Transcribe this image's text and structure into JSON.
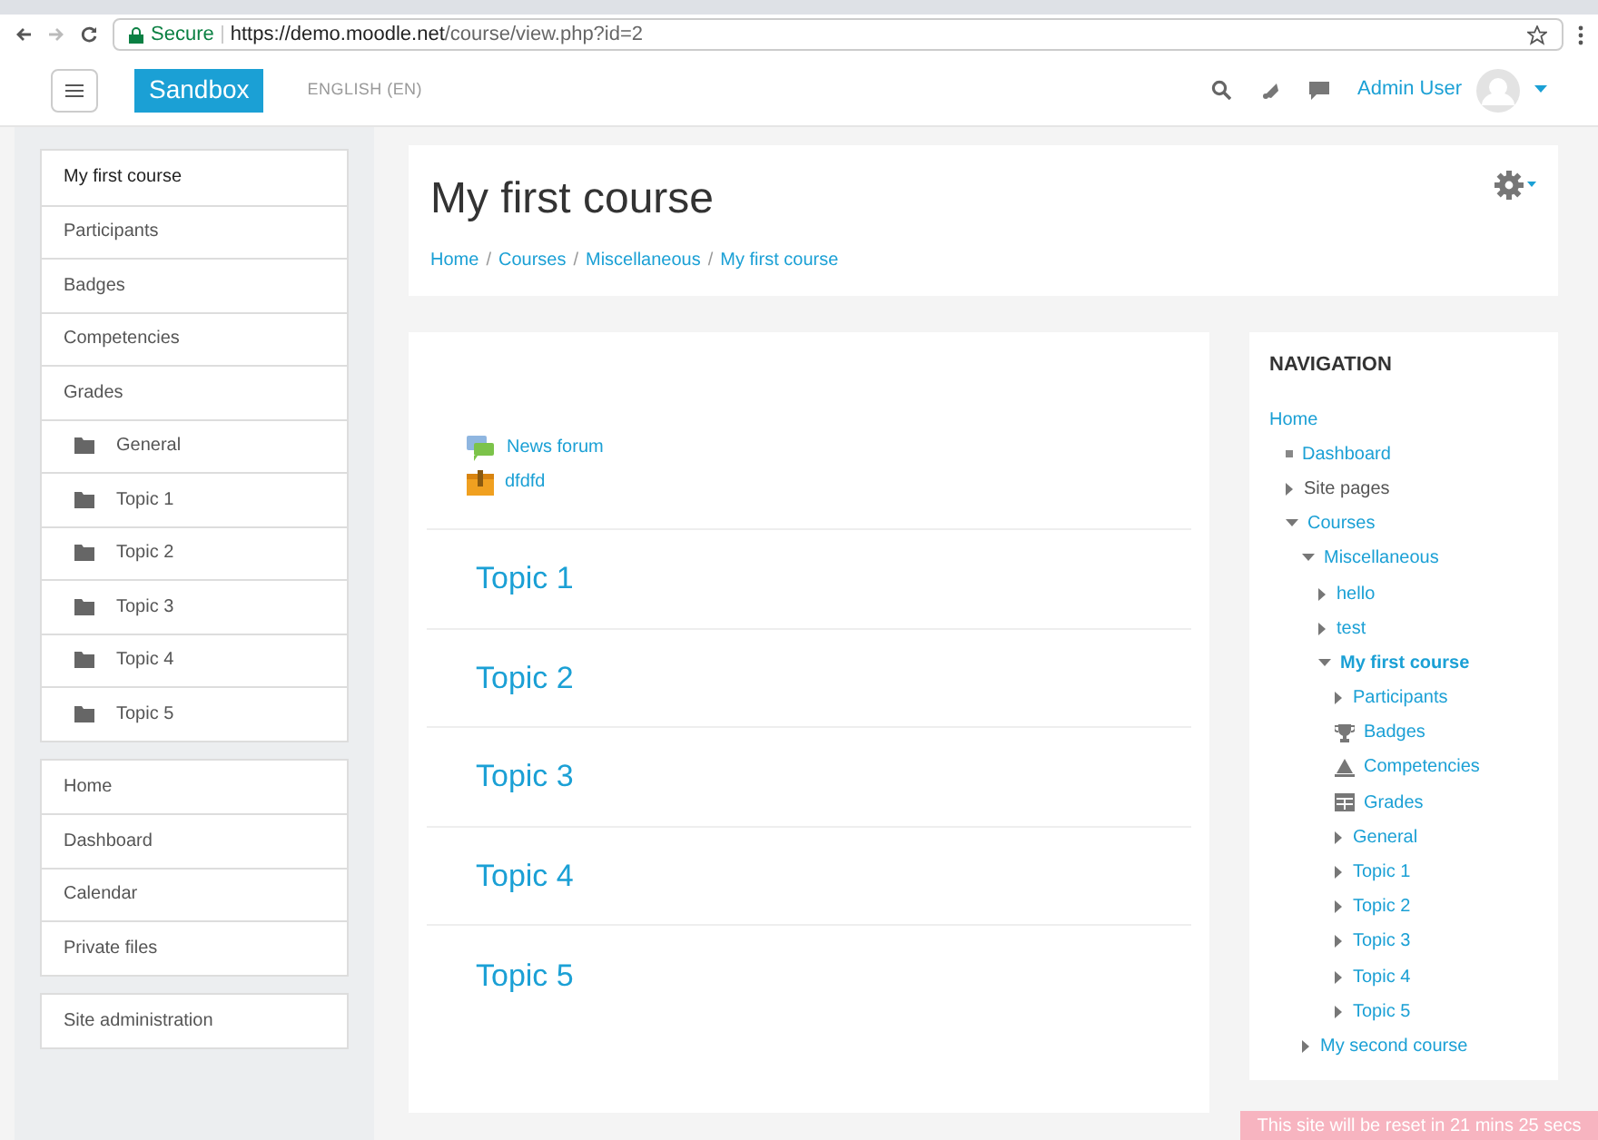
{
  "browser": {
    "secure_label": "Secure",
    "url_host": "https://demo.moodle.net",
    "url_path": "/course/view.php?id=2"
  },
  "navbar": {
    "brand": "Sandbox",
    "language": "ENGLISH (EN)",
    "user": "Admin User"
  },
  "sidebar": {
    "groups": [
      [
        {
          "label": "My first course",
          "kind": "heading"
        },
        {
          "label": "Participants",
          "kind": "link"
        },
        {
          "label": "Badges",
          "kind": "link"
        },
        {
          "label": "Competencies",
          "kind": "link"
        },
        {
          "label": "Grades",
          "kind": "link"
        },
        {
          "label": "General",
          "kind": "section"
        },
        {
          "label": "Topic 1",
          "kind": "section"
        },
        {
          "label": "Topic 2",
          "kind": "section"
        },
        {
          "label": "Topic 3",
          "kind": "section"
        },
        {
          "label": "Topic 4",
          "kind": "section"
        },
        {
          "label": "Topic 5",
          "kind": "section"
        }
      ],
      [
        {
          "label": "Home",
          "kind": "link"
        },
        {
          "label": "Dashboard",
          "kind": "link"
        },
        {
          "label": "Calendar",
          "kind": "link"
        },
        {
          "label": "Private files",
          "kind": "link"
        }
      ],
      [
        {
          "label": "Site administration",
          "kind": "link"
        }
      ]
    ]
  },
  "header": {
    "title": "My first course",
    "separator": "/",
    "breadcrumbs": [
      "Home",
      "Courses",
      "Miscellaneous",
      "My first course"
    ]
  },
  "course": {
    "activities": [
      {
        "label": "News forum",
        "kind": "forum"
      },
      {
        "label": "dfdfd",
        "kind": "resource"
      }
    ],
    "topics": [
      "Topic 1",
      "Topic 2",
      "Topic 3",
      "Topic 4",
      "Topic 5"
    ]
  },
  "navigation": {
    "title": "NAVIGATION",
    "items": [
      {
        "label": "Home",
        "kind": "root",
        "active": false,
        "children": [
          {
            "label": "Dashboard",
            "kind": "bullet",
            "active": false
          },
          {
            "label": "Site pages",
            "kind": "category",
            "expanded": false,
            "active": false
          },
          {
            "label": "Courses",
            "kind": "branch",
            "expanded": true,
            "active": false,
            "children": [
              {
                "label": "Miscellaneous",
                "kind": "branch",
                "expanded": true,
                "active": false,
                "children": [
                  {
                    "label": "hello",
                    "kind": "branch",
                    "expanded": false,
                    "active": false
                  },
                  {
                    "label": "test",
                    "kind": "branch",
                    "expanded": false,
                    "active": false
                  },
                  {
                    "label": "My first course",
                    "kind": "branch",
                    "expanded": true,
                    "active": true,
                    "children": [
                      {
                        "label": "Participants",
                        "kind": "branch",
                        "expanded": false,
                        "active": false
                      },
                      {
                        "label": "Badges",
                        "kind": "badge",
                        "active": false
                      },
                      {
                        "label": "Competencies",
                        "kind": "competency",
                        "active": false
                      },
                      {
                        "label": "Grades",
                        "kind": "grades",
                        "active": false
                      },
                      {
                        "label": "General",
                        "kind": "branch",
                        "expanded": false,
                        "active": false
                      },
                      {
                        "label": "Topic 1",
                        "kind": "branch",
                        "expanded": false,
                        "active": false
                      },
                      {
                        "label": "Topic 2",
                        "kind": "branch",
                        "expanded": false,
                        "active": false
                      },
                      {
                        "label": "Topic 3",
                        "kind": "branch",
                        "expanded": false,
                        "active": false
                      },
                      {
                        "label": "Topic 4",
                        "kind": "branch",
                        "expanded": false,
                        "active": false
                      },
                      {
                        "label": "Topic 5",
                        "kind": "branch",
                        "expanded": false,
                        "active": false
                      }
                    ]
                  }
                ]
              },
              {
                "label": "My second course",
                "kind": "branch",
                "expanded": false,
                "active": false
              }
            ]
          }
        ]
      }
    ]
  },
  "notice": "This site will be reset in 21 mins 25 secs"
}
